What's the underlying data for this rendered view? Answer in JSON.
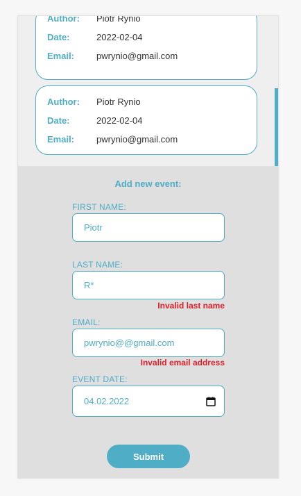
{
  "events": [
    {
      "author_label": "Author:",
      "author": "Piotr Rynio",
      "date_label": "Date:",
      "date": "2022-02-04",
      "email_label": "Email:",
      "email": "pwrynio@gmail.com"
    },
    {
      "author_label": "Author:",
      "author": "Piotr Rynio",
      "date_label": "Date:",
      "date": "2022-02-04",
      "email_label": "Email:",
      "email": "pwrynio@gmail.com"
    }
  ],
  "form": {
    "title": "Add new event:",
    "first_name": {
      "label": "FIRST NAME:",
      "value": "Piotr"
    },
    "last_name": {
      "label": "LAST NAME:",
      "value": "R*",
      "error": "Invalid last name"
    },
    "email": {
      "label": "EMAIL:",
      "value": "pwrynio@@gmail.com",
      "error": "Invalid email address"
    },
    "event_date": {
      "label": "EVENT DATE:",
      "value": "04.02.2022",
      "icon": "calendar-icon"
    },
    "submit_label": "Submit"
  },
  "colors": {
    "accent": "#4fadc6",
    "error": "#e0202a"
  }
}
